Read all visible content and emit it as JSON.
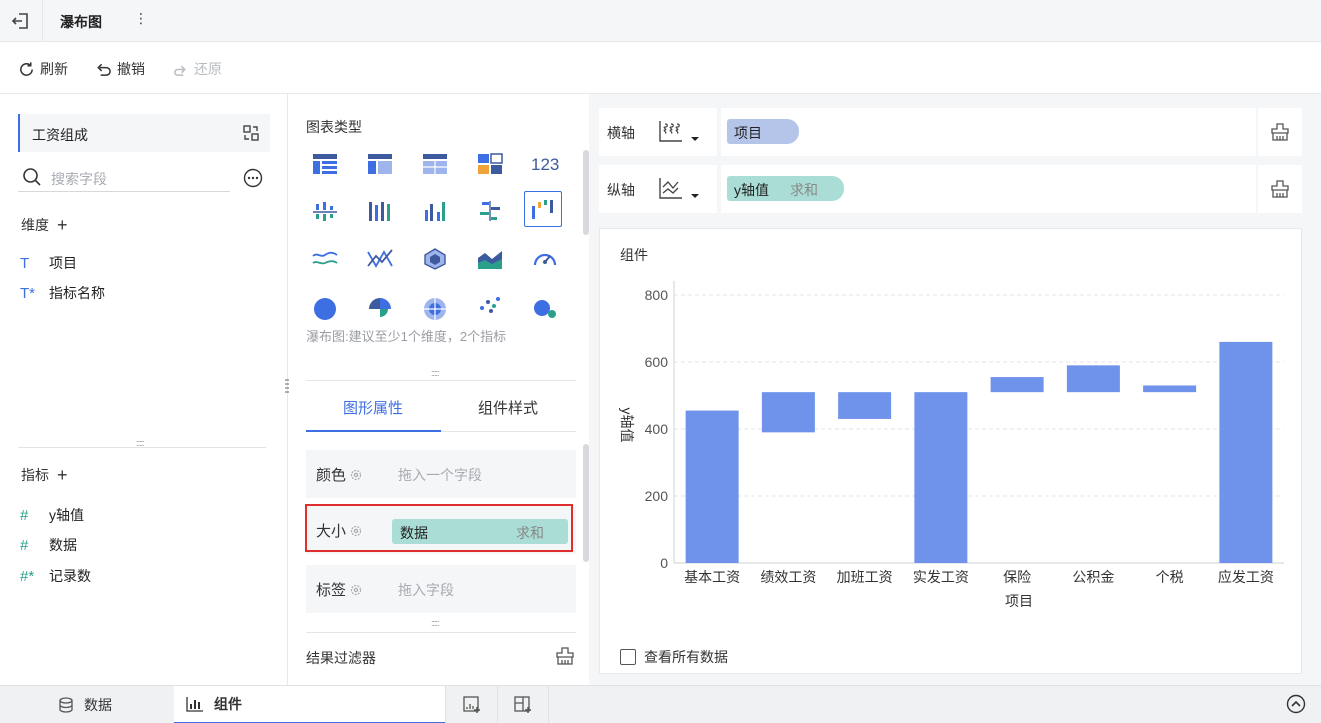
{
  "header": {
    "title": "瀑布图",
    "more_glyph": "⋮"
  },
  "toolbar": {
    "refresh": "刷新",
    "undo": "撤销",
    "redo": "还原"
  },
  "left": {
    "dataset_name": "工资组成",
    "search_placeholder": "搜索字段",
    "dimensions_label": "维度",
    "dimensions": [
      {
        "icon": "T",
        "label": "项目"
      },
      {
        "icon": "T*",
        "label": "指标名称"
      }
    ],
    "measures_label": "指标",
    "measures": [
      {
        "icon": "#",
        "label": "y轴值"
      },
      {
        "icon": "#",
        "label": "数据"
      },
      {
        "icon": "#*",
        "label": "记录数"
      }
    ]
  },
  "middle": {
    "chart_type_label": "图表类型",
    "chart_type_hint": "瀑布图:建议至少1个维度，2个指标",
    "tabs": [
      "图形属性",
      "组件样式"
    ],
    "active_tab": "图形属性",
    "props": [
      {
        "label": "颜色",
        "placeholder": "拖入一个字段"
      },
      {
        "label": "大小",
        "field": "数据",
        "agg": "求和"
      },
      {
        "label": "标签",
        "placeholder": "拖入字段"
      }
    ],
    "filter_label": "结果过滤器"
  },
  "axes": {
    "x_label": "横轴",
    "x_field": "项目",
    "y_label": "纵轴",
    "y_field": "y轴值",
    "y_agg": "求和"
  },
  "chart_card": {
    "title": "组件",
    "view_all": "查看所有数据"
  },
  "chart_data": {
    "type": "bar",
    "subtype": "waterfall",
    "categories": [
      "基本工资",
      "绩效工资",
      "加班工资",
      "实发工资",
      "保险",
      "公积金",
      "个税",
      "应发工资"
    ],
    "series": [
      {
        "ranges": [
          [
            0,
            455
          ],
          [
            390,
            510
          ],
          [
            430,
            510
          ],
          [
            0,
            510
          ],
          [
            510,
            555
          ],
          [
            510,
            590
          ],
          [
            510,
            530
          ],
          [
            0,
            660
          ]
        ]
      }
    ],
    "bar_color": "#6f93ea",
    "xlabel": "项目",
    "ylabel": "y轴值",
    "ylim": [
      0,
      800
    ],
    "yticks": [
      0,
      200,
      400,
      600,
      800
    ],
    "grid": true
  },
  "bottom": {
    "tab_data": "数据",
    "tab_component": "组件"
  }
}
